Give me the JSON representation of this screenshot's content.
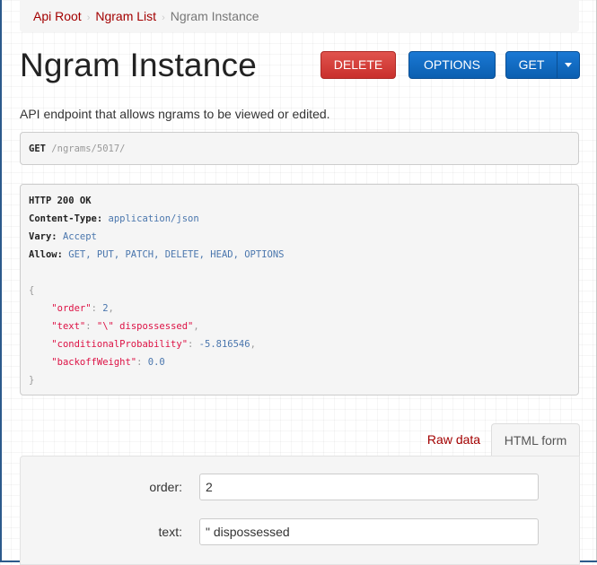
{
  "breadcrumb": {
    "items": [
      {
        "label": "Api Root"
      },
      {
        "label": "Ngram List"
      },
      {
        "label": "Ngram Instance"
      }
    ],
    "separator": "›"
  },
  "page": {
    "title": "Ngram Instance",
    "description": "API endpoint that allows ngrams to be viewed or edited."
  },
  "buttons": {
    "delete": "DELETE",
    "options": "OPTIONS",
    "get": "GET",
    "caret_icon": "caret-down-icon"
  },
  "request": {
    "method": "GET",
    "path": "/ngrams/5017/"
  },
  "response": {
    "status": "HTTP 200 OK",
    "headers": [
      {
        "name": "Content-Type:",
        "value": "application/json"
      },
      {
        "name": "Vary:",
        "value": "Accept"
      },
      {
        "name": "Allow:",
        "value": "GET, PUT, PATCH, DELETE, HEAD, OPTIONS"
      }
    ],
    "body_open": "{",
    "body_close": "}",
    "fields": [
      {
        "key": "\"order\"",
        "colon": ": ",
        "value": "2",
        "type": "num",
        "comma": ","
      },
      {
        "key": "\"text\"",
        "colon": ": ",
        "value": "\"\\\" dispossessed\"",
        "type": "str",
        "comma": ","
      },
      {
        "key": "\"conditionalProbability\"",
        "colon": ": ",
        "value": "-5.816546",
        "type": "num",
        "comma": ","
      },
      {
        "key": "\"backoffWeight\"",
        "colon": ": ",
        "value": "0.0",
        "type": "num",
        "comma": ""
      }
    ]
  },
  "tabs": {
    "raw": "Raw data",
    "html": "HTML form"
  },
  "form": {
    "order_label": "order:",
    "order_value": "2",
    "text_label": "text:",
    "text_value": "\" dispossessed"
  },
  "colors": {
    "link": "#a30000",
    "danger": "#d9534f",
    "primary": "#0b66c3"
  }
}
